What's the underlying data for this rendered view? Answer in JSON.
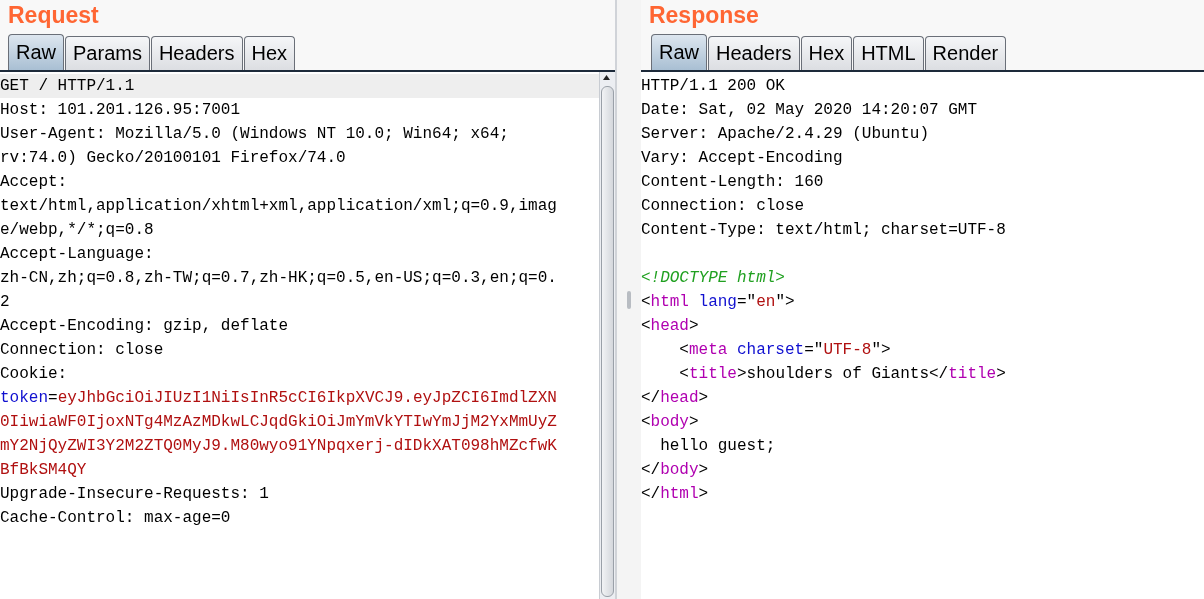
{
  "request": {
    "title": "Request",
    "tabs": [
      {
        "label": "Raw",
        "selected": true
      },
      {
        "label": "Params",
        "selected": false
      },
      {
        "label": "Headers",
        "selected": false
      },
      {
        "label": "Hex",
        "selected": false
      }
    ],
    "lines": [
      {
        "current": true,
        "parts": [
          {
            "kind": "plain",
            "text": "GET / HTTP/1.1"
          }
        ]
      },
      {
        "current": false,
        "parts": [
          {
            "kind": "plain",
            "text": "Host: 101.201.126.95:7001"
          }
        ]
      },
      {
        "current": false,
        "parts": [
          {
            "kind": "plain",
            "text": "User-Agent: Mozilla/5.0 (Windows NT 10.0; Win64; x64;"
          }
        ]
      },
      {
        "current": false,
        "parts": [
          {
            "kind": "plain",
            "text": "rv:74.0) Gecko/20100101 Firefox/74.0"
          }
        ]
      },
      {
        "current": false,
        "parts": [
          {
            "kind": "plain",
            "text": "Accept:"
          }
        ]
      },
      {
        "current": false,
        "parts": [
          {
            "kind": "plain",
            "text": "text/html,application/xhtml+xml,application/xml;q=0.9,imag"
          }
        ]
      },
      {
        "current": false,
        "parts": [
          {
            "kind": "plain",
            "text": "e/webp,*/*;q=0.8"
          }
        ]
      },
      {
        "current": false,
        "parts": [
          {
            "kind": "plain",
            "text": "Accept-Language:"
          }
        ]
      },
      {
        "current": false,
        "parts": [
          {
            "kind": "plain",
            "text": "zh-CN,zh;q=0.8,zh-TW;q=0.7,zh-HK;q=0.5,en-US;q=0.3,en;q=0."
          }
        ]
      },
      {
        "current": false,
        "parts": [
          {
            "kind": "plain",
            "text": "2"
          }
        ]
      },
      {
        "current": false,
        "parts": [
          {
            "kind": "plain",
            "text": "Accept-Encoding: gzip, deflate"
          }
        ]
      },
      {
        "current": false,
        "parts": [
          {
            "kind": "plain",
            "text": "Connection: close"
          }
        ]
      },
      {
        "current": false,
        "parts": [
          {
            "kind": "plain",
            "text": "Cookie:"
          }
        ]
      },
      {
        "current": false,
        "parts": [
          {
            "kind": "key",
            "text": "token"
          },
          {
            "kind": "plain",
            "text": "="
          },
          {
            "kind": "value",
            "text": "eyJhbGciOiJIUzI1NiIsInR5cCI6IkpXVCJ9.eyJpZCI6ImdlZXN"
          }
        ]
      },
      {
        "current": false,
        "parts": [
          {
            "kind": "value",
            "text": "0IiwiaWF0IjoxNTg4MzAzMDkwLCJqdGkiOiJmYmVkYTIwYmJjM2YxMmUyZ"
          }
        ]
      },
      {
        "current": false,
        "parts": [
          {
            "kind": "value",
            "text": "mY2NjQyZWI3Y2M2ZTQ0MyJ9.M80wyo91YNpqxerj-dIDkXAT098hMZcfwK"
          }
        ]
      },
      {
        "current": false,
        "parts": [
          {
            "kind": "value",
            "text": "BfBkSM4QY"
          }
        ]
      },
      {
        "current": false,
        "parts": [
          {
            "kind": "plain",
            "text": "Upgrade-Insecure-Requests: 1"
          }
        ]
      },
      {
        "current": false,
        "parts": [
          {
            "kind": "plain",
            "text": "Cache-Control: max-age=0"
          }
        ]
      }
    ]
  },
  "response": {
    "title": "Response",
    "tabs": [
      {
        "label": "Raw",
        "selected": true
      },
      {
        "label": "Headers",
        "selected": false
      },
      {
        "label": "Hex",
        "selected": false
      },
      {
        "label": "HTML",
        "selected": false
      },
      {
        "label": "Render",
        "selected": false
      }
    ],
    "headers": [
      {
        "parts": [
          {
            "kind": "plain",
            "text": "HTTP/1.1 200 OK"
          }
        ]
      },
      {
        "parts": [
          {
            "kind": "plain",
            "text": "Date: Sat, 02 May 2020 14:20:07 GMT"
          }
        ]
      },
      {
        "parts": [
          {
            "kind": "plain",
            "text": "Server: Apache/2.4.29 (Ubuntu)"
          }
        ]
      },
      {
        "parts": [
          {
            "kind": "plain",
            "text": "Vary: Accept-Encoding"
          }
        ]
      },
      {
        "parts": [
          {
            "kind": "plain",
            "text": "Content-Length: 160"
          }
        ]
      },
      {
        "parts": [
          {
            "kind": "plain",
            "text": "Connection: close"
          }
        ]
      },
      {
        "parts": [
          {
            "kind": "plain",
            "text": "Content-Type: text/html; charset=UTF-8"
          }
        ]
      }
    ],
    "body": [
      {
        "parts": [
          {
            "kind": "comment",
            "text": "<!DOCTYPE html>"
          }
        ]
      },
      {
        "parts": [
          {
            "kind": "plain",
            "text": "<"
          },
          {
            "kind": "tag",
            "text": "html"
          },
          {
            "kind": "key",
            "text": " lang"
          },
          {
            "kind": "plain",
            "text": "=\""
          },
          {
            "kind": "value",
            "text": "en"
          },
          {
            "kind": "plain",
            "text": "\">"
          }
        ]
      },
      {
        "parts": [
          {
            "kind": "plain",
            "text": "<"
          },
          {
            "kind": "tag",
            "text": "head"
          },
          {
            "kind": "plain",
            "text": ">"
          }
        ]
      },
      {
        "parts": [
          {
            "kind": "plain",
            "text": "    <"
          },
          {
            "kind": "tag",
            "text": "meta"
          },
          {
            "kind": "key",
            "text": " charset"
          },
          {
            "kind": "plain",
            "text": "=\""
          },
          {
            "kind": "value",
            "text": "UTF-8"
          },
          {
            "kind": "plain",
            "text": "\">"
          }
        ]
      },
      {
        "parts": [
          {
            "kind": "plain",
            "text": "    <"
          },
          {
            "kind": "tag",
            "text": "title"
          },
          {
            "kind": "plain",
            "text": ">shoulders of Giants</"
          },
          {
            "kind": "tag",
            "text": "title"
          },
          {
            "kind": "plain",
            "text": ">"
          }
        ]
      },
      {
        "parts": [
          {
            "kind": "plain",
            "text": "</"
          },
          {
            "kind": "tag",
            "text": "head"
          },
          {
            "kind": "plain",
            "text": ">"
          }
        ]
      },
      {
        "parts": [
          {
            "kind": "plain",
            "text": "<"
          },
          {
            "kind": "tag",
            "text": "body"
          },
          {
            "kind": "plain",
            "text": ">"
          }
        ]
      },
      {
        "parts": [
          {
            "kind": "plain",
            "text": "  hello guest;"
          }
        ]
      },
      {
        "parts": [
          {
            "kind": "plain",
            "text": "</"
          },
          {
            "kind": "tag",
            "text": "body"
          },
          {
            "kind": "plain",
            "text": ">"
          }
        ]
      },
      {
        "parts": [
          {
            "kind": "plain",
            "text": "</"
          },
          {
            "kind": "tag",
            "text": "html"
          },
          {
            "kind": "plain",
            "text": ">"
          }
        ]
      }
    ]
  }
}
